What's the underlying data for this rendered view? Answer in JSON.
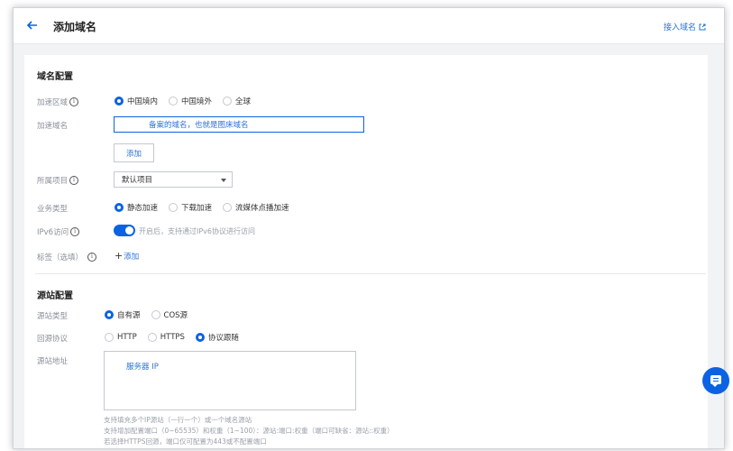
{
  "header": {
    "title": "添加域名",
    "connect_link": "接入域名"
  },
  "domain_config": {
    "section_title": "域名配置",
    "region": {
      "label": "加速区域",
      "options": [
        "中国境内",
        "中国境外",
        "全球"
      ],
      "selected": "中国境内"
    },
    "domain": {
      "label": "加速域名",
      "placeholder": "备案的域名，也就是图床域名",
      "add_button": "添加"
    },
    "project": {
      "label": "所属项目",
      "value": "默认项目"
    },
    "business_type": {
      "label": "业务类型",
      "options": [
        "静态加速",
        "下载加速",
        "流媒体点播加速"
      ],
      "selected": "静态加速"
    },
    "ipv6": {
      "label": "IPv6访问",
      "enabled": true,
      "description": "开启后，支持通过IPv6协议进行访问"
    },
    "tags": {
      "label": "标签（选填）",
      "add_label": "添加"
    }
  },
  "origin_config": {
    "section_title": "源站配置",
    "origin_type": {
      "label": "源站类型",
      "options": [
        "自有源",
        "COS源"
      ],
      "selected": "自有源"
    },
    "protocol": {
      "label": "回源协议",
      "options": [
        "HTTP",
        "HTTPS",
        "协议跟随"
      ],
      "selected": "协议跟随"
    },
    "address": {
      "label": "源站地址",
      "placeholder": "服务器 IP",
      "hints": [
        "支持填充多个IP源站（一行一个）或一个域名源站",
        "支持增加配置端口（0~65535）和权重（1~100）：源站:端口:权重（端口可缺省：源站::权重）",
        "若选择HTTPS回源，端口仅可配置为443或不配置端口"
      ]
    }
  },
  "colors": {
    "accent": "#0b63e3",
    "link": "#2a73d9",
    "background": "#f2f3f5"
  }
}
